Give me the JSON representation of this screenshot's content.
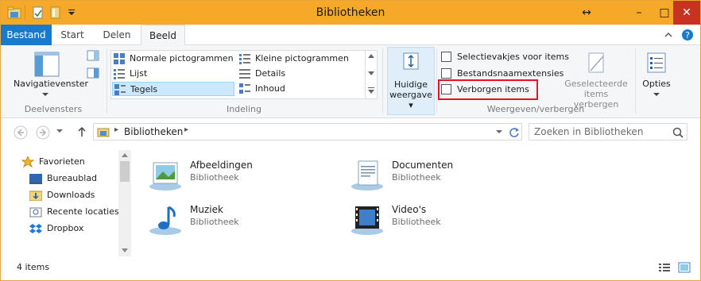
{
  "window": {
    "title": "Bibliotheken"
  },
  "tabs": [
    "Bestand",
    "Start",
    "Delen",
    "Beeld"
  ],
  "ribbon": {
    "panes": {
      "nav_pane_label": "Navigatievenster",
      "group_label": "Deelvensters"
    },
    "layout": {
      "items": [
        "Normale pictogrammen",
        "Kleine pictogrammen",
        "Lijst",
        "Details",
        "Tegels",
        "Inhoud"
      ],
      "group_label": "Indeling"
    },
    "current_view": {
      "label_line1": "Huidige",
      "label_line2": "weergave"
    },
    "show_hide": {
      "checkboxes": [
        "Selectievakjes voor items",
        "Bestandsnaamextensies",
        "Verborgen items"
      ],
      "hide_selected_line1": "Geselecteerde",
      "hide_selected_line2": "items verbergen",
      "group_label": "Weergeven/verbergen"
    },
    "options_label": "Opties"
  },
  "address": {
    "path": "Bibliotheken",
    "search_placeholder": "Zoeken in Bibliotheken"
  },
  "nav": {
    "favorites_label": "Favorieten",
    "items": [
      "Bureaublad",
      "Downloads",
      "Recente locaties",
      "Dropbox"
    ]
  },
  "libraries": [
    {
      "name": "Afbeeldingen",
      "type": "Bibliotheek"
    },
    {
      "name": "Documenten",
      "type": "Bibliotheek"
    },
    {
      "name": "Muziek",
      "type": "Bibliotheek"
    },
    {
      "name": "Video's",
      "type": "Bibliotheek"
    }
  ],
  "status": {
    "count": "4 items"
  },
  "colors": {
    "titlebar": "#f6a928",
    "file_tab": "#1979ca",
    "highlight_box": "#e81123",
    "selected_tile": "#cce8ff"
  }
}
